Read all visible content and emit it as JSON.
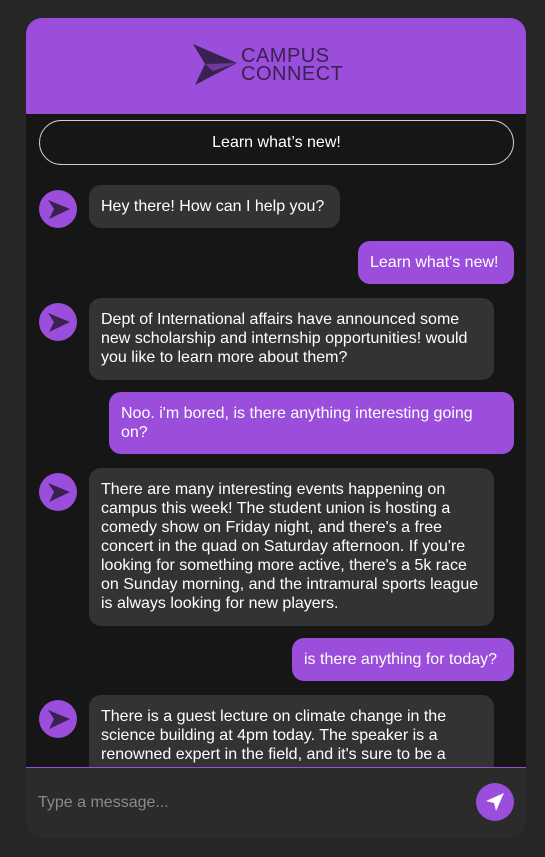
{
  "brand": {
    "line1": "CAMPUS",
    "line2": "CONNECT",
    "accent_color": "#9b4ddc"
  },
  "quick_action": {
    "label": "Learn what’s new!"
  },
  "messages": [
    {
      "sender": "bot",
      "text": "Hey there! How can I help you?"
    },
    {
      "sender": "user",
      "text": "Learn what's new!"
    },
    {
      "sender": "bot",
      "text": "Dept of International affairs have announced some new scholarship and internship opportunities! would you like to learn more about them?"
    },
    {
      "sender": "user",
      "text": "Noo. i'm bored, is there anything interesting going on?"
    },
    {
      "sender": "bot",
      "text": "There are many interesting events happening on campus this week! The student union is hosting a comedy show on Friday night, and there's a free concert in the quad on Saturday afternoon. If you're looking for something more active, there's a 5k race on Sunday morning, and the intramural sports league is always looking for new players."
    },
    {
      "sender": "user",
      "text": "is there anything for today?"
    },
    {
      "sender": "bot",
      "text": "There is a guest lecture on climate change in the science building at 4pm today. The speaker is a renowned expert in the field, and it's sure to be a"
    }
  ],
  "composer": {
    "placeholder": "Type a message...",
    "value": ""
  },
  "icons": {
    "logo": "campus-connect-logo-icon",
    "avatar": "bot-avatar-icon",
    "send": "send-icon"
  }
}
